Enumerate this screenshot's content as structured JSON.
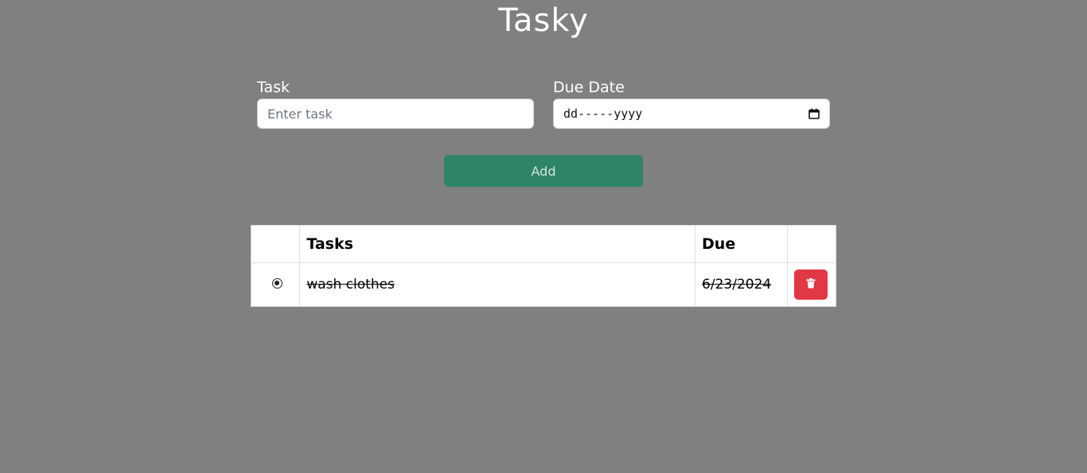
{
  "app": {
    "title": "Tasky"
  },
  "form": {
    "task_label": "Task",
    "task_placeholder": "Enter task",
    "task_value": "",
    "due_label": "Due Date",
    "due_placeholder": "dd-----yyyy",
    "add_label": "Add"
  },
  "table": {
    "headers": [
      "",
      "Tasks",
      "Due",
      ""
    ],
    "rows": [
      {
        "checked": true,
        "task": "wash clothes",
        "due": "6/23/2024",
        "done": true
      }
    ]
  },
  "icons": {
    "calendar": "calendar-icon",
    "delete": "trash-icon",
    "radio": "radio-selected-icon"
  },
  "colors": {
    "background": "#808080",
    "add_button": "#2e8467",
    "delete_button": "#e23744"
  }
}
